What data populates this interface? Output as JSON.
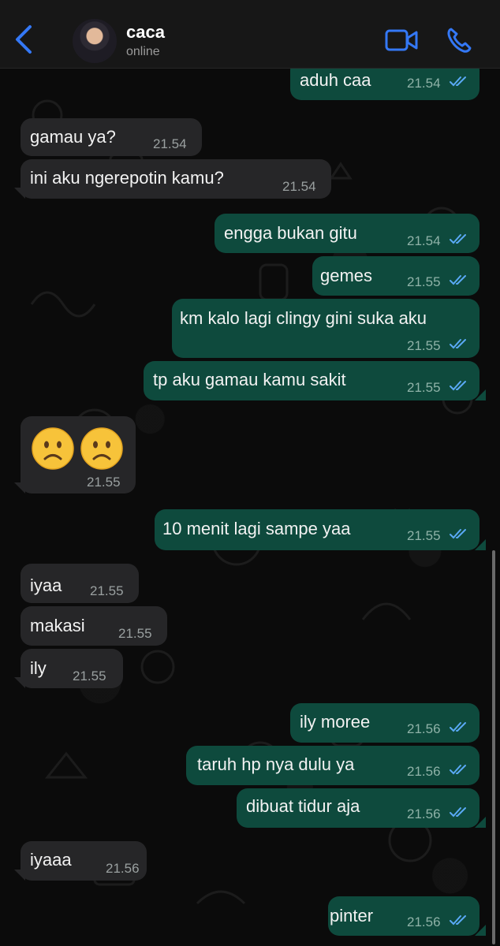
{
  "header": {
    "contact_name": "caca",
    "contact_status": "online",
    "accent_color": "#3478f6",
    "icons": [
      "back-chevron-icon",
      "video-call-icon",
      "phone-call-icon"
    ]
  },
  "messages": [
    {
      "direction": "out",
      "text": "aduh caa",
      "time": "21.54"
    },
    {
      "direction": "in",
      "text": "gamau ya?",
      "time": "21.54"
    },
    {
      "direction": "in",
      "text": "ini aku ngerepotin kamu?",
      "time": "21.54"
    },
    {
      "direction": "out",
      "text": "engga bukan gitu",
      "time": "21.54"
    },
    {
      "direction": "out",
      "text": "gemes",
      "time": "21.55"
    },
    {
      "direction": "out",
      "text": "km kalo lagi clingy gini suka aku",
      "time": "21.55"
    },
    {
      "direction": "out",
      "text": "tp aku gamau kamu sakit",
      "time": "21.55"
    },
    {
      "direction": "in",
      "text": "☹️ ☹️",
      "time": "21.55"
    },
    {
      "direction": "out",
      "text": "10 menit lagi sampe yaa",
      "time": "21.55"
    },
    {
      "direction": "in",
      "text": "iyaa",
      "time": "21.55"
    },
    {
      "direction": "in",
      "text": "makasi",
      "time": "21.55"
    },
    {
      "direction": "in",
      "text": "ily",
      "time": "21.55"
    },
    {
      "direction": "out",
      "text": "ily moree",
      "time": "21.56"
    },
    {
      "direction": "out",
      "text": "taruh hp nya dulu ya",
      "time": "21.56"
    },
    {
      "direction": "out",
      "text": "dibuat tidur aja",
      "time": "21.56"
    },
    {
      "direction": "in",
      "text": "iyaaa",
      "time": "21.56"
    },
    {
      "direction": "out",
      "text": "pinter",
      "time": "21.56"
    }
  ],
  "colors": {
    "incoming_bubble": "#262628",
    "outgoing_bubble": "#0e4a3d",
    "read_ticks": "#5aa9f5"
  }
}
